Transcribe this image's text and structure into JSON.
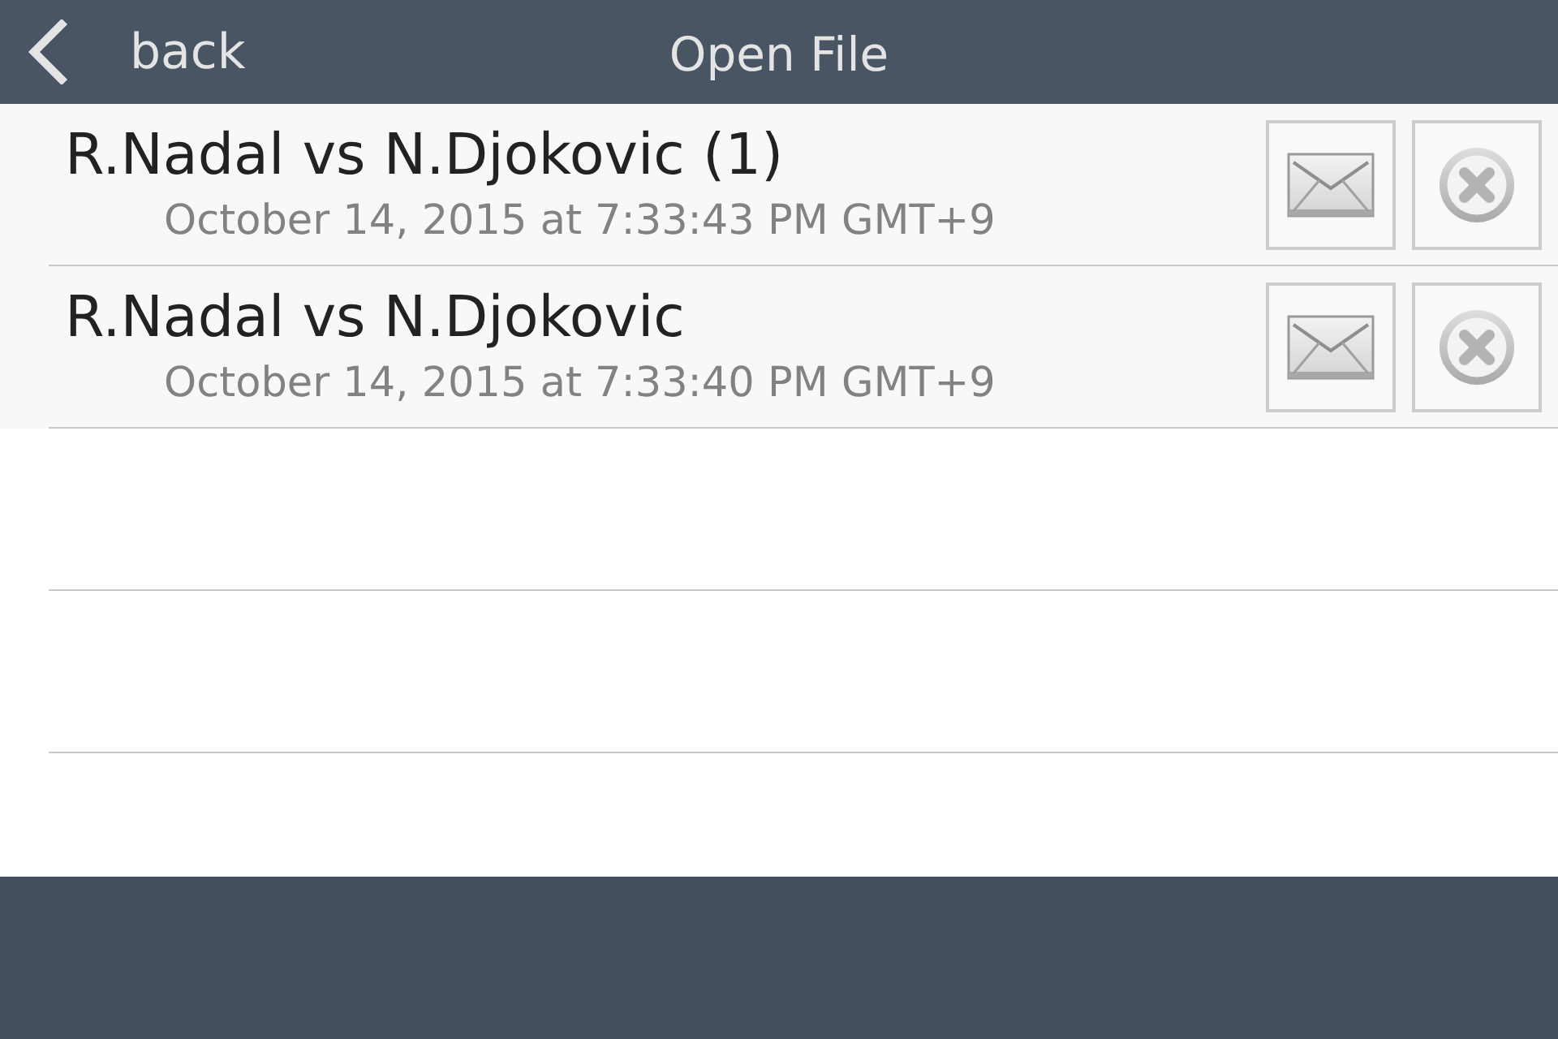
{
  "nav_bar": {
    "back_label": "back",
    "title": "Open File"
  },
  "files": [
    {
      "name": "R.Nadal vs N.Djokovic (1)",
      "date": "October 14, 2015 at 7:33:43 PM GMT+9"
    },
    {
      "name": "R.Nadal vs N.Djokovic",
      "date": "October 14, 2015 at 7:33:40 PM GMT+9"
    }
  ]
}
